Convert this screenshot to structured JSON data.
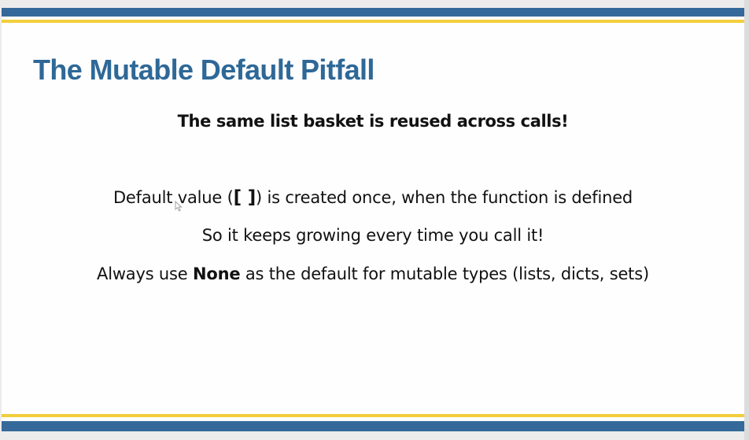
{
  "slide": {
    "title": "The Mutable Default Pitfall",
    "subtitle": "The same list basket is reused across calls!",
    "lines": [
      {
        "before": "Default value (",
        "code": "[ ]",
        "after": ") is created once, when the function is defined"
      },
      {
        "text": "So it keeps growing every time you call it!"
      },
      {
        "before": "Always use ",
        "bold": "None",
        "after": " as the default for mutable types (lists, dicts, sets)"
      }
    ]
  },
  "colors": {
    "accent_blue": "#35699a",
    "accent_gold": "#f2ce3c",
    "title_blue": "#2e6897"
  },
  "icons": {
    "cursor": "mouse-pointer-icon"
  }
}
